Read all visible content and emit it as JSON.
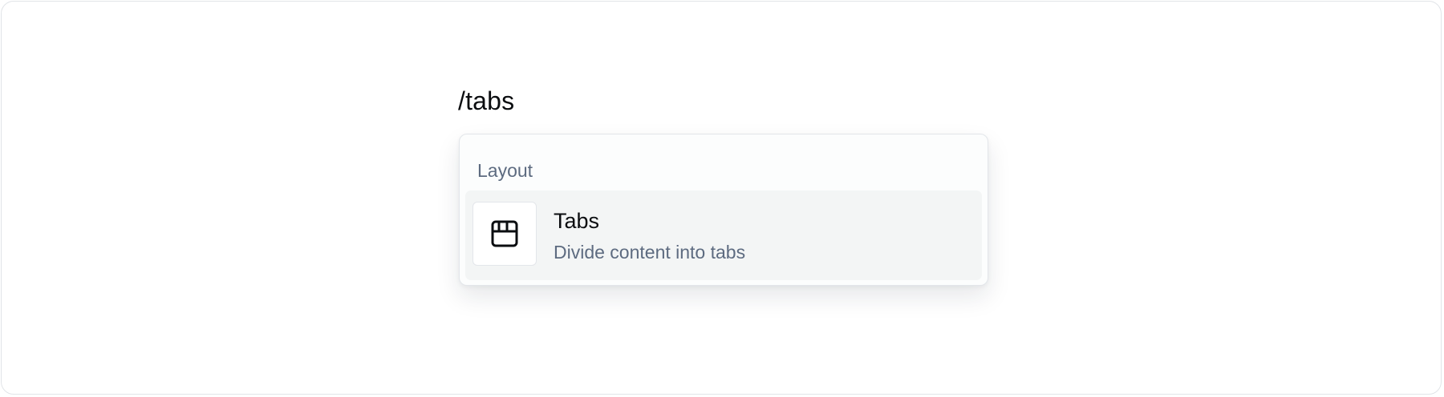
{
  "editor": {
    "command_text": "/tabs"
  },
  "slash_menu": {
    "group_label": "Layout",
    "items": [
      {
        "title": "Tabs",
        "description": "Divide content into tabs",
        "icon": "tabs-icon"
      }
    ]
  },
  "colors": {
    "text_primary": "#0b0d10",
    "text_secondary": "#5d6b80",
    "item_highlight": "#f3f5f5",
    "border": "#e3e6ea"
  }
}
